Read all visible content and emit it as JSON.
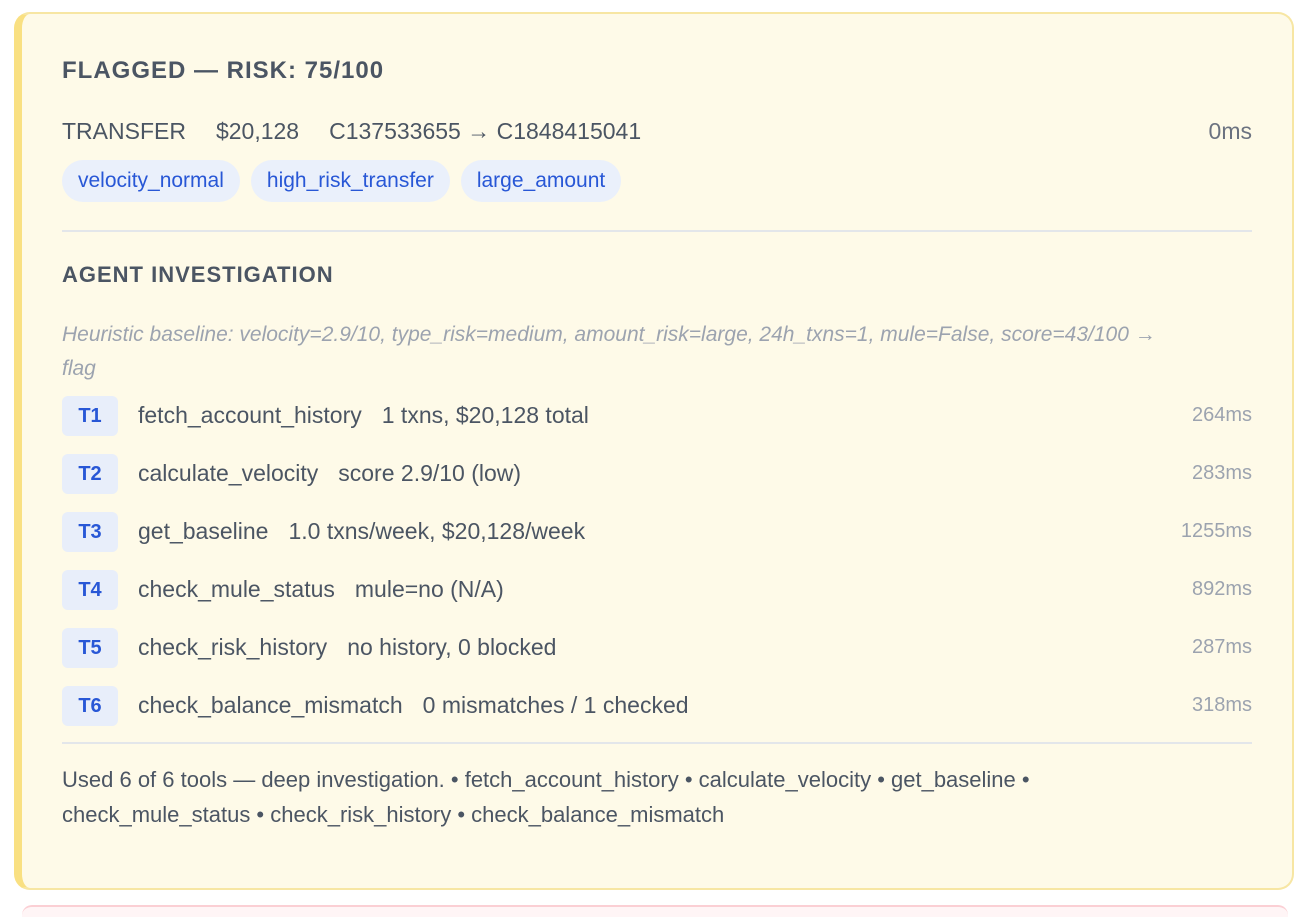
{
  "card": {
    "title": "FLAGGED — RISK: 75/100",
    "transaction": {
      "type": "TRANSFER",
      "amount": "$20,128",
      "route": "C137533655 → C1848415041",
      "latency": "0ms"
    },
    "tags": [
      "velocity_normal",
      "high_risk_transfer",
      "large_amount"
    ],
    "investigation": {
      "heading": "AGENT INVESTIGATION",
      "baseline": "Heuristic baseline: velocity=2.9/10, type_risk=medium, amount_risk=large, 24h_txns=1, mule=False, score=43/100 → flag",
      "tools": [
        {
          "id": "T1",
          "name": "fetch_account_history",
          "result": "1 txns, $20,128 total",
          "time": "264ms"
        },
        {
          "id": "T2",
          "name": "calculate_velocity",
          "result": "score 2.9/10 (low)",
          "time": "283ms"
        },
        {
          "id": "T3",
          "name": "get_baseline",
          "result": "1.0 txns/week, $20,128/week",
          "time": "1255ms"
        },
        {
          "id": "T4",
          "name": "check_mule_status",
          "result": "mule=no (N/A)",
          "time": "892ms"
        },
        {
          "id": "T5",
          "name": "check_risk_history",
          "result": "no history, 0 blocked",
          "time": "287ms"
        },
        {
          "id": "T6",
          "name": "check_balance_mismatch",
          "result": "0 mismatches / 1 checked",
          "time": "318ms"
        }
      ],
      "summary": "Used 6 of 6 tools — deep investigation. • fetch_account_history • calculate_velocity • get_baseline • check_mule_status • check_risk_history • check_balance_mismatch"
    }
  },
  "colors": {
    "card_background": "#fefae8",
    "card_border": "#f7e6a3",
    "accent_bar": "#f9e082",
    "tag_text": "#2857d6",
    "tag_background": "#eaf0fb"
  }
}
